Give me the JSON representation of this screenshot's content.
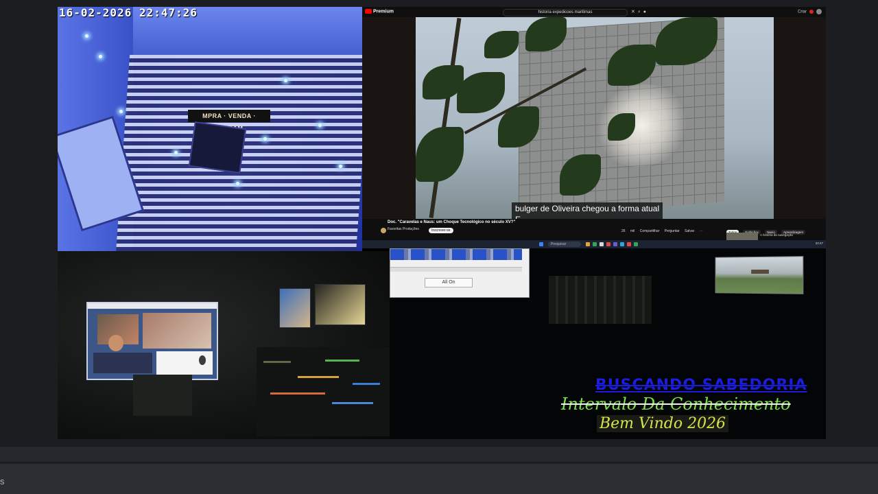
{
  "camera": {
    "timestamp": "16-02-2026  22:47:26",
    "sign_text": "MPRA · VENDA · LOTSAM"
  },
  "browser": {
    "logo_text": "Premium",
    "search_text": "historia expedicoes maritimas",
    "account_text": "Criar",
    "subtitle_line1": "bulger de Oliveira chegou a forma atual",
    "subtitle_line2": "E",
    "video_title": "Doc. \"Caravelas e Naus: um Choque Tecnológico no século XV?\"",
    "channel_name": "Favoritas Produções",
    "subscribe_label": "Inscrever-se",
    "actions": [
      "26 mil",
      "Compartilhar",
      "Perguntar",
      "Salvar",
      "⋯"
    ],
    "chips": [
      {
        "label": "Todos",
        "active": true
      },
      {
        "label": "Exibiçãox",
        "active": false
      },
      {
        "label": "Navio",
        "active": false
      },
      {
        "label": "Aprendizagem",
        "active": false
      }
    ],
    "suggestion_text": "A história da navegação"
  },
  "taskbar": {
    "search_placeholder": "Pesquisar",
    "clock": "22:47"
  },
  "dialog": {
    "button_label": "All On"
  },
  "overlay": {
    "line1": "BUSCANDO SABEDORIA",
    "line2": "Intervalo Da Conhecimento",
    "line3": "Bem Vindo 2026"
  },
  "chrome": {
    "edge_label": "s"
  },
  "colors": {
    "overlay_blue": "#1d1de0",
    "overlay_green": "#7ee24a",
    "overlay_yellow": "#d2e64b",
    "app_background": "#1b1d21"
  }
}
